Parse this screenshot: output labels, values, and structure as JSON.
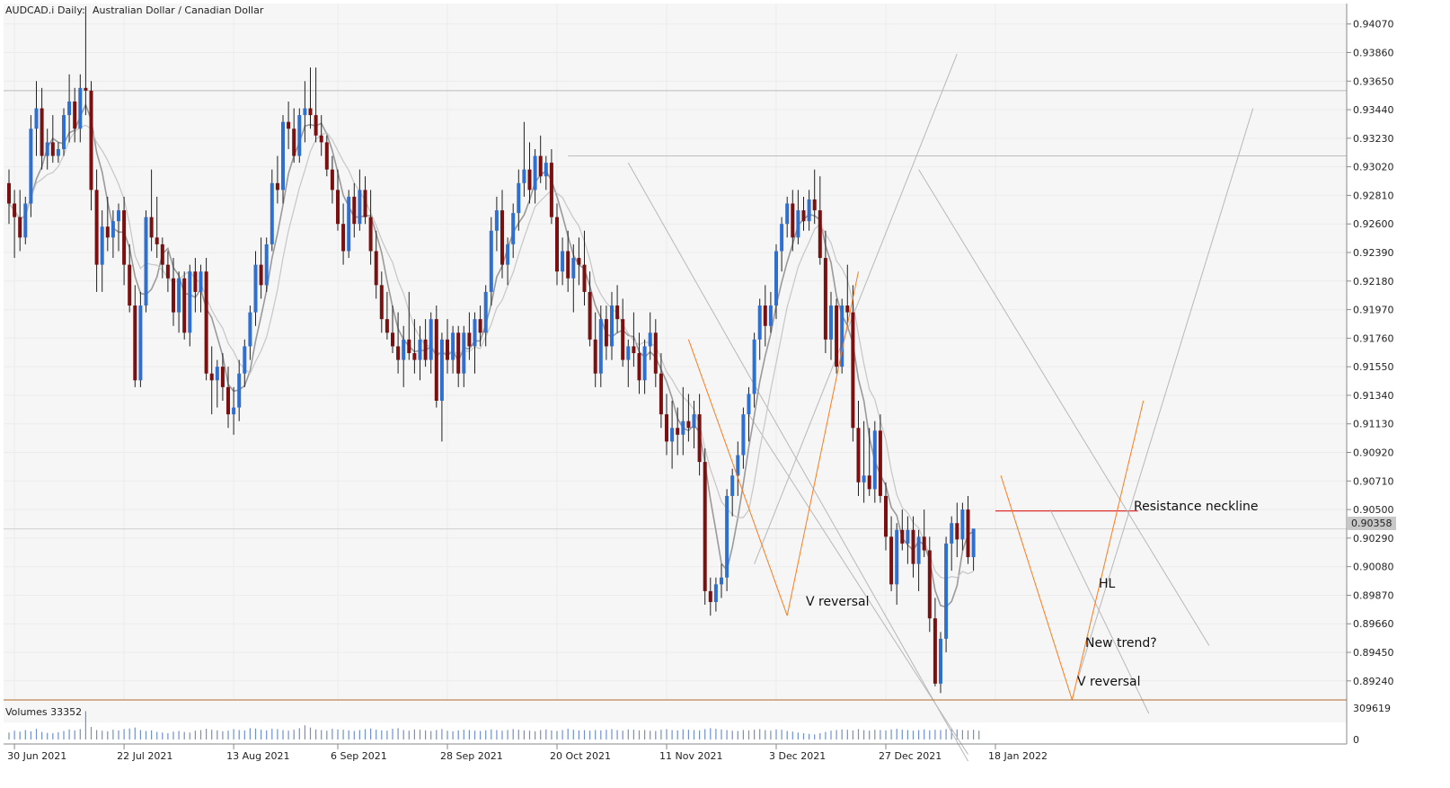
{
  "header": {
    "symbol": "AUDCAD.i",
    "timeframe": "Daily:",
    "description": "Australian Dollar / Canadian Dollar",
    "volumes_label": "Volumes 33352"
  },
  "colors": {
    "bull": "#2f6fd0",
    "bear": "#7a1010",
    "wick": "#202020",
    "ma_fast": "#9a9a9a",
    "ma_slow": "#c6c6c6",
    "resistance": "#e03030",
    "v_lines": "#ff7a1a",
    "trend_lines": "#b8b8b8",
    "volume": "#7090d0",
    "grid": "#ececec",
    "current_price_tag": "#c8c8c8"
  },
  "chart_data": {
    "type": "candlestick",
    "price_axis": {
      "ticks": [
        "0.94070",
        "0.93860",
        "0.93650",
        "0.93440",
        "0.93230",
        "0.93020",
        "0.92810",
        "0.92600",
        "0.92390",
        "0.92180",
        "0.91970",
        "0.91760",
        "0.91550",
        "0.91340",
        "0.91130",
        "0.90920",
        "0.90710",
        "0.90500",
        "0.90290",
        "0.90080",
        "0.89870",
        "0.89660",
        "0.89450",
        "0.89240"
      ],
      "range": [
        0.891,
        0.9422
      ]
    },
    "volume_axis": {
      "ticks": [
        "309619",
        "0"
      ]
    },
    "date_labels": [
      {
        "label": "30 Jun 2021",
        "index": 1
      },
      {
        "label": "22 Jul 2021",
        "index": 21
      },
      {
        "label": "13 Aug 2021",
        "index": 41
      },
      {
        "label": "6 Sep 2021",
        "index": 60
      },
      {
        "label": "28 Sep 2021",
        "index": 80
      },
      {
        "label": "20 Oct 2021",
        "index": 100
      },
      {
        "label": "11 Nov 2021",
        "index": 120
      },
      {
        "label": "3 Dec 2021",
        "index": 140
      },
      {
        "label": "27 Dec 2021",
        "index": 160
      },
      {
        "label": "18 Jan 2022",
        "index": 180
      }
    ],
    "current_price": "0.90358",
    "resistance_price": 0.9049,
    "horizontal_levels": [
      0.9358,
      0.931
    ],
    "candles": [
      [
        0.929,
        0.93,
        0.926,
        0.9275
      ],
      [
        0.9275,
        0.9285,
        0.9235,
        0.9265
      ],
      [
        0.9265,
        0.9285,
        0.924,
        0.925
      ],
      [
        0.925,
        0.928,
        0.9245,
        0.9275
      ],
      [
        0.9275,
        0.934,
        0.9265,
        0.933
      ],
      [
        0.933,
        0.9365,
        0.931,
        0.9345
      ],
      [
        0.9345,
        0.936,
        0.93,
        0.931
      ],
      [
        0.931,
        0.933,
        0.93,
        0.932
      ],
      [
        0.932,
        0.934,
        0.9305,
        0.931
      ],
      [
        0.931,
        0.932,
        0.9305,
        0.9315
      ],
      [
        0.9315,
        0.9345,
        0.931,
        0.934
      ],
      [
        0.934,
        0.937,
        0.932,
        0.935
      ],
      [
        0.935,
        0.936,
        0.932,
        0.933
      ],
      [
        0.933,
        0.937,
        0.932,
        0.936
      ],
      [
        0.936,
        0.942,
        0.934,
        0.9358
      ],
      [
        0.9358,
        0.9365,
        0.927,
        0.9285
      ],
      [
        0.9285,
        0.93,
        0.921,
        0.923
      ],
      [
        0.923,
        0.927,
        0.921,
        0.9258
      ],
      [
        0.9258,
        0.928,
        0.924,
        0.925
      ],
      [
        0.925,
        0.927,
        0.9235,
        0.9262
      ],
      [
        0.9262,
        0.9275,
        0.924,
        0.927
      ],
      [
        0.927,
        0.928,
        0.9215,
        0.923
      ],
      [
        0.923,
        0.9245,
        0.9195,
        0.92
      ],
      [
        0.92,
        0.9215,
        0.914,
        0.9145
      ],
      [
        0.9145,
        0.921,
        0.914,
        0.92
      ],
      [
        0.92,
        0.927,
        0.9195,
        0.9265
      ],
      [
        0.9265,
        0.93,
        0.924,
        0.925
      ],
      [
        0.925,
        0.928,
        0.9235,
        0.9245
      ],
      [
        0.9245,
        0.925,
        0.922,
        0.923
      ],
      [
        0.923,
        0.924,
        0.921,
        0.922
      ],
      [
        0.922,
        0.9235,
        0.9185,
        0.9195
      ],
      [
        0.9195,
        0.9225,
        0.918,
        0.922
      ],
      [
        0.922,
        0.9225,
        0.9175,
        0.918
      ],
      [
        0.918,
        0.923,
        0.917,
        0.9225
      ],
      [
        0.9225,
        0.9235,
        0.9195,
        0.921
      ],
      [
        0.921,
        0.923,
        0.9195,
        0.9225
      ],
      [
        0.9225,
        0.9235,
        0.9145,
        0.915
      ],
      [
        0.915,
        0.917,
        0.912,
        0.9145
      ],
      [
        0.9145,
        0.916,
        0.9125,
        0.9155
      ],
      [
        0.9155,
        0.9165,
        0.913,
        0.914
      ],
      [
        0.914,
        0.9155,
        0.911,
        0.912
      ],
      [
        0.912,
        0.914,
        0.9105,
        0.9125
      ],
      [
        0.9125,
        0.916,
        0.9115,
        0.915
      ],
      [
        0.915,
        0.9175,
        0.914,
        0.917
      ],
      [
        0.917,
        0.92,
        0.916,
        0.9195
      ],
      [
        0.9195,
        0.924,
        0.9185,
        0.923
      ],
      [
        0.923,
        0.925,
        0.9205,
        0.9215
      ],
      [
        0.9215,
        0.925,
        0.921,
        0.9245
      ],
      [
        0.9245,
        0.93,
        0.924,
        0.929
      ],
      [
        0.929,
        0.931,
        0.9275,
        0.9285
      ],
      [
        0.9285,
        0.934,
        0.9275,
        0.9335
      ],
      [
        0.9335,
        0.935,
        0.9315,
        0.933
      ],
      [
        0.933,
        0.9345,
        0.9305,
        0.931
      ],
      [
        0.931,
        0.9345,
        0.9305,
        0.934
      ],
      [
        0.934,
        0.9365,
        0.932,
        0.9345
      ],
      [
        0.9345,
        0.9375,
        0.933,
        0.934
      ],
      [
        0.934,
        0.9375,
        0.932,
        0.9325
      ],
      [
        0.9325,
        0.934,
        0.931,
        0.932
      ],
      [
        0.932,
        0.9325,
        0.9295,
        0.93
      ],
      [
        0.93,
        0.931,
        0.9275,
        0.9285
      ],
      [
        0.9285,
        0.93,
        0.9255,
        0.926
      ],
      [
        0.926,
        0.9275,
        0.923,
        0.924
      ],
      [
        0.924,
        0.9285,
        0.9235,
        0.928
      ],
      [
        0.928,
        0.929,
        0.925,
        0.926
      ],
      [
        0.926,
        0.93,
        0.9255,
        0.9285
      ],
      [
        0.9285,
        0.9295,
        0.926,
        0.9265
      ],
      [
        0.9265,
        0.9285,
        0.923,
        0.924
      ],
      [
        0.924,
        0.9255,
        0.9205,
        0.9215
      ],
      [
        0.9215,
        0.9225,
        0.918,
        0.919
      ],
      [
        0.919,
        0.921,
        0.9175,
        0.918
      ],
      [
        0.918,
        0.92,
        0.9165,
        0.917
      ],
      [
        0.917,
        0.9195,
        0.915,
        0.916
      ],
      [
        0.916,
        0.9185,
        0.914,
        0.9175
      ],
      [
        0.9175,
        0.921,
        0.916,
        0.9165
      ],
      [
        0.9165,
        0.919,
        0.915,
        0.916
      ],
      [
        0.916,
        0.9185,
        0.9145,
        0.9175
      ],
      [
        0.9175,
        0.919,
        0.9155,
        0.916
      ],
      [
        0.916,
        0.9195,
        0.915,
        0.919
      ],
      [
        0.919,
        0.92,
        0.9125,
        0.913
      ],
      [
        0.913,
        0.918,
        0.91,
        0.9175
      ],
      [
        0.9175,
        0.919,
        0.915,
        0.916
      ],
      [
        0.916,
        0.9185,
        0.915,
        0.918
      ],
      [
        0.918,
        0.9185,
        0.914,
        0.915
      ],
      [
        0.915,
        0.9185,
        0.914,
        0.918
      ],
      [
        0.918,
        0.9195,
        0.916,
        0.917
      ],
      [
        0.917,
        0.9195,
        0.915,
        0.919
      ],
      [
        0.919,
        0.92,
        0.917,
        0.918
      ],
      [
        0.918,
        0.9215,
        0.917,
        0.921
      ],
      [
        0.921,
        0.9265,
        0.92,
        0.9255
      ],
      [
        0.9255,
        0.928,
        0.924,
        0.927
      ],
      [
        0.927,
        0.9285,
        0.922,
        0.923
      ],
      [
        0.923,
        0.925,
        0.9215,
        0.9245
      ],
      [
        0.9245,
        0.9275,
        0.9235,
        0.9268
      ],
      [
        0.9268,
        0.93,
        0.9255,
        0.929
      ],
      [
        0.929,
        0.9335,
        0.928,
        0.93
      ],
      [
        0.93,
        0.932,
        0.9275,
        0.9285
      ],
      [
        0.9285,
        0.9315,
        0.9275,
        0.931
      ],
      [
        0.931,
        0.9325,
        0.929,
        0.9295
      ],
      [
        0.9295,
        0.931,
        0.9285,
        0.9305
      ],
      [
        0.9305,
        0.9315,
        0.926,
        0.9265
      ],
      [
        0.9265,
        0.9275,
        0.9215,
        0.9225
      ],
      [
        0.9225,
        0.925,
        0.9215,
        0.924
      ],
      [
        0.924,
        0.9255,
        0.921,
        0.922
      ],
      [
        0.922,
        0.9245,
        0.9195,
        0.9235
      ],
      [
        0.9235,
        0.925,
        0.9215,
        0.923
      ],
      [
        0.923,
        0.9255,
        0.92,
        0.921
      ],
      [
        0.921,
        0.9225,
        0.917,
        0.9175
      ],
      [
        0.9175,
        0.9195,
        0.914,
        0.915
      ],
      [
        0.915,
        0.92,
        0.914,
        0.919
      ],
      [
        0.919,
        0.92,
        0.916,
        0.917
      ],
      [
        0.917,
        0.921,
        0.916,
        0.92
      ],
      [
        0.92,
        0.9215,
        0.918,
        0.919
      ],
      [
        0.919,
        0.9205,
        0.9155,
        0.916
      ],
      [
        0.916,
        0.9175,
        0.914,
        0.917
      ],
      [
        0.917,
        0.9195,
        0.9155,
        0.9165
      ],
      [
        0.9165,
        0.918,
        0.9135,
        0.9145
      ],
      [
        0.9145,
        0.9175,
        0.9135,
        0.917
      ],
      [
        0.917,
        0.9195,
        0.916,
        0.918
      ],
      [
        0.918,
        0.919,
        0.914,
        0.915
      ],
      [
        0.915,
        0.9165,
        0.911,
        0.912
      ],
      [
        0.912,
        0.9135,
        0.909,
        0.91
      ],
      [
        0.91,
        0.913,
        0.908,
        0.911
      ],
      [
        0.911,
        0.9125,
        0.909,
        0.9105
      ],
      [
        0.9105,
        0.914,
        0.909,
        0.9115
      ],
      [
        0.9115,
        0.9135,
        0.91,
        0.911
      ],
      [
        0.911,
        0.913,
        0.9095,
        0.912
      ],
      [
        0.912,
        0.9135,
        0.9075,
        0.9085
      ],
      [
        0.9085,
        0.9095,
        0.898,
        0.899
      ],
      [
        0.899,
        0.9,
        0.8972,
        0.8982
      ],
      [
        0.8982,
        0.9,
        0.8975,
        0.8995
      ],
      [
        0.8995,
        0.901,
        0.8985,
        0.9
      ],
      [
        0.9,
        0.9065,
        0.899,
        0.906
      ],
      [
        0.906,
        0.908,
        0.9045,
        0.9075
      ],
      [
        0.9075,
        0.91,
        0.906,
        0.909
      ],
      [
        0.909,
        0.9125,
        0.908,
        0.912
      ],
      [
        0.912,
        0.914,
        0.91,
        0.9135
      ],
      [
        0.9135,
        0.918,
        0.9125,
        0.9175
      ],
      [
        0.9175,
        0.9205,
        0.916,
        0.92
      ],
      [
        0.92,
        0.9215,
        0.917,
        0.9185
      ],
      [
        0.9185,
        0.921,
        0.918,
        0.92
      ],
      [
        0.92,
        0.9245,
        0.919,
        0.924
      ],
      [
        0.924,
        0.9265,
        0.9225,
        0.926
      ],
      [
        0.926,
        0.928,
        0.925,
        0.9275
      ],
      [
        0.9275,
        0.9285,
        0.924,
        0.925
      ],
      [
        0.925,
        0.9285,
        0.9245,
        0.927
      ],
      [
        0.927,
        0.928,
        0.9255,
        0.9262
      ],
      [
        0.9262,
        0.9285,
        0.9255,
        0.9278
      ],
      [
        0.9278,
        0.93,
        0.926,
        0.927
      ],
      [
        0.927,
        0.9295,
        0.923,
        0.9235
      ],
      [
        0.9235,
        0.9255,
        0.9165,
        0.9175
      ],
      [
        0.9175,
        0.921,
        0.916,
        0.92
      ],
      [
        0.92,
        0.9205,
        0.915,
        0.9155
      ],
      [
        0.9155,
        0.9205,
        0.915,
        0.92
      ],
      [
        0.92,
        0.923,
        0.9185,
        0.9195
      ],
      [
        0.9195,
        0.9215,
        0.91,
        0.911
      ],
      [
        0.911,
        0.913,
        0.906,
        0.907
      ],
      [
        0.907,
        0.9115,
        0.9055,
        0.9075
      ],
      [
        0.9075,
        0.911,
        0.906,
        0.9065
      ],
      [
        0.9065,
        0.9115,
        0.9055,
        0.9108
      ],
      [
        0.9108,
        0.912,
        0.9055,
        0.906
      ],
      [
        0.906,
        0.907,
        0.902,
        0.903
      ],
      [
        0.903,
        0.9045,
        0.899,
        0.8995
      ],
      [
        0.8995,
        0.904,
        0.898,
        0.9035
      ],
      [
        0.9035,
        0.905,
        0.902,
        0.9025
      ],
      [
        0.9025,
        0.9045,
        0.901,
        0.9035
      ],
      [
        0.9035,
        0.9045,
        0.9,
        0.901
      ],
      [
        0.901,
        0.9035,
        0.899,
        0.903
      ],
      [
        0.903,
        0.905,
        0.9015,
        0.902
      ],
      [
        0.902,
        0.903,
        0.896,
        0.897
      ],
      [
        0.897,
        0.8985,
        0.892,
        0.8922
      ],
      [
        0.8922,
        0.896,
        0.8915,
        0.8955
      ],
      [
        0.8955,
        0.903,
        0.8945,
        0.9025
      ],
      [
        0.9025,
        0.9045,
        0.9005,
        0.904
      ],
      [
        0.904,
        0.9055,
        0.9015,
        0.9028
      ],
      [
        0.9028,
        0.9055,
        0.902,
        0.905
      ],
      [
        0.905,
        0.906,
        0.901,
        0.9015
      ],
      [
        0.9015,
        0.9035,
        0.9005,
        0.9036
      ]
    ],
    "volumes": [
      0.22,
      0.28,
      0.25,
      0.3,
      0.26,
      0.34,
      0.24,
      0.21,
      0.2,
      0.23,
      0.27,
      0.32,
      0.29,
      0.33,
      0.9,
      0.4,
      0.3,
      0.28,
      0.26,
      0.31,
      0.29,
      0.33,
      0.35,
      0.38,
      0.3,
      0.27,
      0.29,
      0.24,
      0.22,
      0.2,
      0.25,
      0.27,
      0.24,
      0.22,
      0.28,
      0.3,
      0.34,
      0.31,
      0.29,
      0.26,
      0.28,
      0.33,
      0.3,
      0.29,
      0.36,
      0.35,
      0.31,
      0.29,
      0.34,
      0.33,
      0.3,
      0.28,
      0.31,
      0.36,
      0.45,
      0.38,
      0.32,
      0.3,
      0.28,
      0.34,
      0.32,
      0.31,
      0.29,
      0.27,
      0.3,
      0.33,
      0.35,
      0.31,
      0.29,
      0.28,
      0.34,
      0.36,
      0.3,
      0.28,
      0.32,
      0.31,
      0.29,
      0.27,
      0.3,
      0.33,
      0.28,
      0.26,
      0.29,
      0.31,
      0.3,
      0.28,
      0.27,
      0.29,
      0.32,
      0.3,
      0.28,
      0.3,
      0.33,
      0.31,
      0.29,
      0.28,
      0.26,
      0.3,
      0.32,
      0.29,
      0.27,
      0.3,
      0.34,
      0.31,
      0.29,
      0.3,
      0.28,
      0.3,
      0.29,
      0.31,
      0.33,
      0.3,
      0.28,
      0.32,
      0.31,
      0.29,
      0.3,
      0.28,
      0.27,
      0.31,
      0.33,
      0.3,
      0.29,
      0.32,
      0.31,
      0.3,
      0.29,
      0.33,
      0.36,
      0.34,
      0.32,
      0.3,
      0.28,
      0.27,
      0.3,
      0.29,
      0.31,
      0.33,
      0.3,
      0.28,
      0.32,
      0.31,
      0.27,
      0.25,
      0.22,
      0.2,
      0.18,
      0.16,
      0.2,
      0.24,
      0.28,
      0.3,
      0.32,
      0.31,
      0.29,
      0.33,
      0.3,
      0.28,
      0.31,
      0.3,
      0.29,
      0.32,
      0.34,
      0.31,
      0.3,
      0.28,
      0.3,
      0.32,
      0.29,
      0.31,
      0.3,
      0.33,
      0.35,
      0.32,
      0.3,
      0.29,
      0.31,
      0.28
    ],
    "annotations": [
      {
        "text": "Resistance neckline"
      },
      {
        "text": "V reversal"
      },
      {
        "text": "HL"
      },
      {
        "text": "New trend?"
      },
      {
        "text": "V reversal"
      }
    ]
  }
}
